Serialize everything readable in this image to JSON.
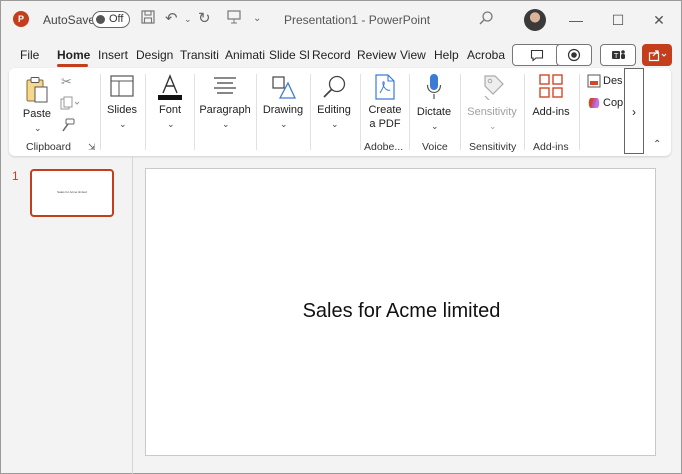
{
  "titlebar": {
    "autosave_label": "AutoSave",
    "autosave_state": "Off",
    "document_title": "Presentation1  -  PowerPoint",
    "app_icon_letter": "P"
  },
  "tabs": [
    {
      "label": "File"
    },
    {
      "label": "Home",
      "active": true
    },
    {
      "label": "Insert"
    },
    {
      "label": "Design"
    },
    {
      "label": "Transiti"
    },
    {
      "label": "Animati"
    },
    {
      "label": "Slide Sl"
    },
    {
      "label": "Record"
    },
    {
      "label": "Review"
    },
    {
      "label": "View"
    },
    {
      "label": "Help"
    },
    {
      "label": "Acroba"
    }
  ],
  "ribbon": {
    "paste": "Paste",
    "slides": "Slides",
    "font": "Font",
    "paragraph": "Paragraph",
    "drawing": "Drawing",
    "editing": "Editing",
    "create_pdf_1": "Create",
    "create_pdf_2": "a PDF",
    "dictate": "Dictate",
    "sensitivity": "Sensitivity",
    "addins": "Add-ins",
    "designer": "Des",
    "copilot": "Cop",
    "groups": {
      "clipboard": "Clipboard",
      "adobe": "Adobe...",
      "voice": "Voice",
      "sensitivity": "Sensitivity",
      "addins": "Add-ins"
    },
    "overflow": "›"
  },
  "slide_pane": {
    "slide_number": "1",
    "thumb_text": "Sales for Acme limited"
  },
  "slide": {
    "title": "Sales for Acme limited"
  },
  "colors": {
    "accent": "#c43e1c"
  }
}
